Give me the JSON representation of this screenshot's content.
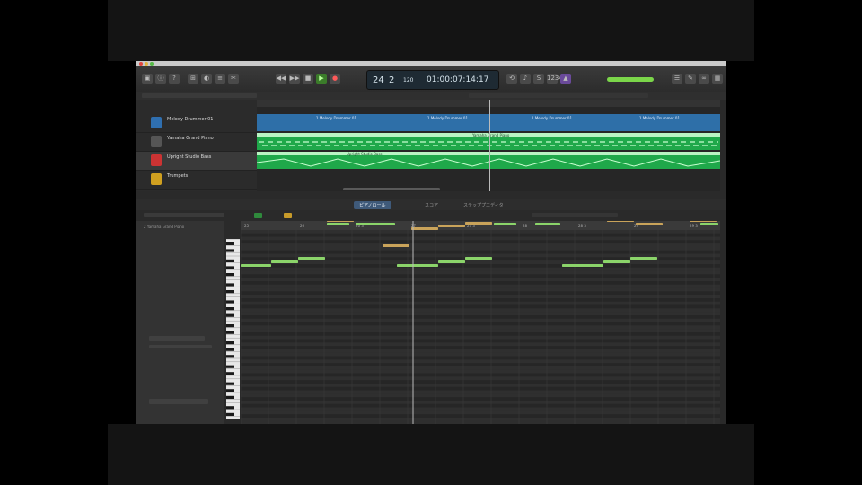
{
  "window": {
    "title_bar_color": "#c9c9c9"
  },
  "toolbar": {
    "lcd": {
      "bar": "24",
      "beat": "2",
      "tempo_label": "120",
      "time": "01:00:07:14:17"
    },
    "master_volume_color": "#7bd64a"
  },
  "tracks": [
    {
      "name": "Melody Drummer 01",
      "thumb_color": "#2f6fb0",
      "selected": false
    },
    {
      "name": "Yamaha Grand Piano",
      "thumb_color": "#555555",
      "selected": false
    },
    {
      "name": "Upright Studio Bass",
      "thumb_color": "#cc3333",
      "selected": true
    },
    {
      "name": "Trumpets",
      "thumb_color": "#d0a020",
      "selected": false
    }
  ],
  "regions": {
    "drummer_label": "1 Melody Drummer 01",
    "piano_label": "Yamaha Grand Piano",
    "bass_label": "Upright Studio Bass",
    "drummer_color": "#2e6fa8",
    "midi_color": "#1fa84a"
  },
  "editor": {
    "tabs": [
      {
        "label": "ピアノロール",
        "active": true
      },
      {
        "label": "スコア",
        "active": false
      },
      {
        "label": "ステッププエディタ",
        "active": false
      }
    ],
    "inspector": {
      "region_label": "2 Yamaha Grand Piano"
    }
  },
  "piano_roll": {
    "ruler_labels": [
      "25",
      "26",
      "26 3",
      "27",
      "27 3",
      "28",
      "28 3",
      "29",
      "29 3"
    ],
    "notes_colors": {
      "green": "#8bd46a",
      "tan": "#c9a35a"
    }
  }
}
